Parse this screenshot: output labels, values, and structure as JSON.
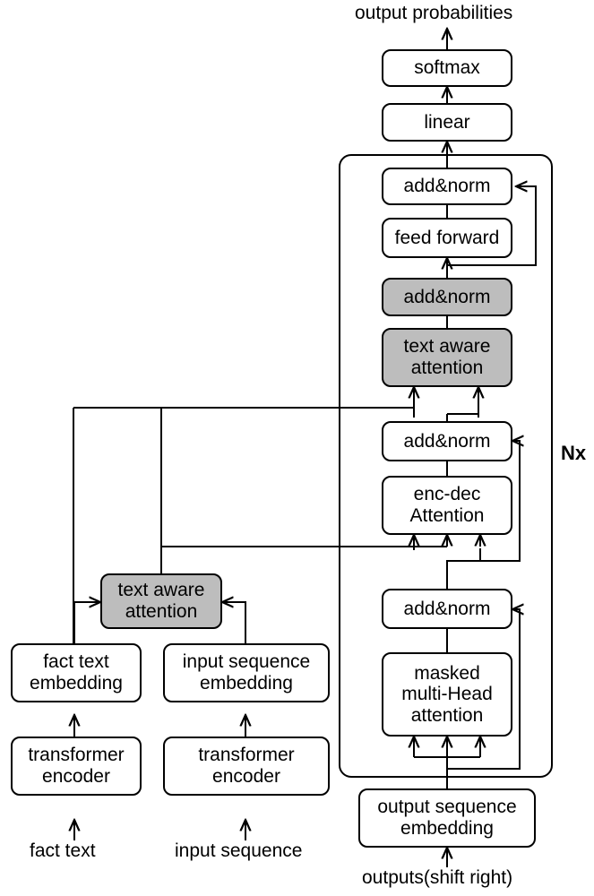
{
  "diagram": {
    "title_text": "output probabilities",
    "repeat_label": "Nx",
    "colors": {
      "shaded_fill": "#bdbdbd",
      "plain_fill": "#ffffff",
      "stroke": "#000000"
    },
    "nodes": {
      "softmax": "softmax",
      "linear": "linear",
      "addnorm_top": "add&norm",
      "feed_forward": "feed forward",
      "addnorm_taa": "add&norm",
      "text_aware_attention_dec": "text aware\nattention",
      "addnorm_encdec": "add&norm",
      "enc_dec_attention": "enc-dec\nAttention",
      "addnorm_masked": "add&norm",
      "masked_multihead_attention": "masked\nmulti-Head\nattention",
      "output_sequence_embedding": "output sequence\nembedding",
      "text_aware_attention_enc": "text aware\nattention",
      "fact_text_embedding": "fact text\nembedding",
      "input_sequence_embedding": "input sequence\nembedding",
      "transformer_encoder_fact": "transformer\nencoder",
      "transformer_encoder_input": "transformer\nencoder"
    },
    "inputs": {
      "fact_text": "fact text",
      "input_sequence": "input sequence",
      "outputs_shift_right": "outputs(shift right)"
    }
  }
}
